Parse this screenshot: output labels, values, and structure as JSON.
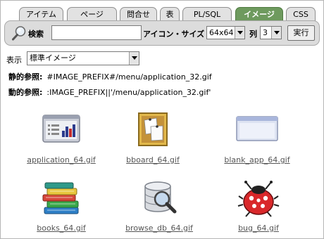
{
  "tabs": [
    {
      "label": "アイテム",
      "active": false
    },
    {
      "label": "ページ",
      "active": false
    },
    {
      "label": "問合せ",
      "active": false
    },
    {
      "label": "表",
      "active": false
    },
    {
      "label": "PL/SQL",
      "active": false
    },
    {
      "label": "イメージ",
      "active": true
    },
    {
      "label": "CSS",
      "active": false
    }
  ],
  "toolbar": {
    "search_label": "検索",
    "search_value": "",
    "icon_size_label": "アイコン・サイズ",
    "icon_size_value": "64x64",
    "columns_label": "列",
    "columns_value": "3",
    "go_label": "実行"
  },
  "display": {
    "label": "表示",
    "value": "標準イメージ"
  },
  "static_ref": {
    "label": "静的参照:",
    "value": "#IMAGE_PREFIX#/menu/application_32.gif"
  },
  "dynamic_ref": {
    "label": "動的参照:",
    "value": ":IMAGE_PREFIX||'/menu/application_32.gif'"
  },
  "images": [
    {
      "name": "application_64.gif",
      "icon": "application-icon"
    },
    {
      "name": "bboard_64.gif",
      "icon": "bulletin-board-icon"
    },
    {
      "name": "blank_app_64.gif",
      "icon": "blank-app-icon"
    },
    {
      "name": "books_64.gif",
      "icon": "books-icon"
    },
    {
      "name": "browse_db_64.gif",
      "icon": "browse-db-icon"
    },
    {
      "name": "bug_64.gif",
      "icon": "bug-icon"
    }
  ],
  "colors": {
    "active_tab": "#6e9a5e",
    "toolbar_bg": "#dcdcdc",
    "link_text": "#555555"
  }
}
